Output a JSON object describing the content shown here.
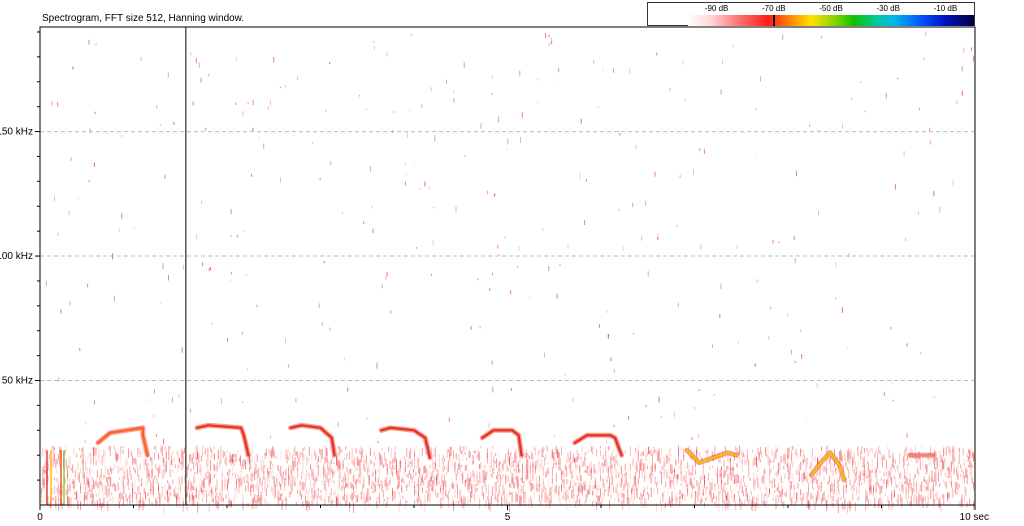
{
  "title": "Spectrogram, FFT size 512, Hanning window.",
  "colorbar": {
    "ticks": [
      {
        "label": "-90 dB",
        "value": -90
      },
      {
        "label": "-70 dB",
        "value": -70
      },
      {
        "label": "-50 dB",
        "value": -50
      },
      {
        "label": "-30 dB",
        "value": -30
      },
      {
        "label": "-10 dB",
        "value": -10
      }
    ],
    "range_db": [
      -100,
      0
    ],
    "marker_db": -70
  },
  "chart_data": {
    "type": "heatmap",
    "xlabel": "",
    "ylabel": "",
    "x_unit": "sec",
    "y_unit": "kHz",
    "xlim": [
      0,
      10
    ],
    "ylim": [
      0,
      192
    ],
    "x_ticks": [
      {
        "value": 0,
        "label": "0"
      },
      {
        "value": 5,
        "label": "5"
      },
      {
        "value": 10,
        "label": "10 sec"
      }
    ],
    "y_ticks": [
      {
        "value": 50,
        "label": "50 kHz"
      },
      {
        "value": 100,
        "label": "100 kHz"
      },
      {
        "value": 150,
        "label": "150 kHz"
      }
    ],
    "grid": "dashed horizontal at labeled kHz ticks",
    "cursor_time_sec": 1.56,
    "noise_band_khz": [
      0,
      24
    ],
    "calls": [
      {
        "t": [
          0.62,
          0.75,
          1.1,
          1.1,
          1.15
        ],
        "f": [
          25,
          29,
          31,
          28,
          20
        ],
        "peak_db": -68
      },
      {
        "t": [
          1.68,
          1.8,
          2.15,
          2.18,
          2.23
        ],
        "f": [
          31,
          32,
          31,
          28,
          20
        ],
        "peak_db": -72
      },
      {
        "t": [
          2.68,
          2.8,
          3.0,
          3.12,
          3.15
        ],
        "f": [
          31,
          32,
          31,
          27,
          20
        ],
        "peak_db": -72
      },
      {
        "t": [
          3.65,
          3.75,
          4.0,
          4.12,
          4.17
        ],
        "f": [
          30,
          31,
          30,
          27,
          19
        ],
        "peak_db": -72
      },
      {
        "t": [
          4.73,
          4.85,
          5.05,
          5.12,
          5.15
        ],
        "f": [
          27,
          30,
          30,
          28,
          20
        ],
        "peak_db": -72
      },
      {
        "t": [
          5.72,
          5.85,
          6.1,
          6.15,
          6.22
        ],
        "f": [
          25,
          28,
          28,
          27,
          20
        ],
        "peak_db": -72
      },
      {
        "t": [
          6.92,
          7.05,
          7.2,
          7.35,
          7.45
        ],
        "f": [
          22,
          17,
          19,
          21,
          20
        ],
        "peak_db": -62
      },
      {
        "t": [
          8.25,
          8.35,
          8.45,
          8.55,
          8.6
        ],
        "f": [
          12,
          17,
          21,
          16,
          10
        ],
        "peak_db": -62
      },
      {
        "t": [
          9.3,
          9.45,
          9.55
        ],
        "f": [
          20,
          20,
          20
        ],
        "peak_db": -88
      }
    ]
  }
}
